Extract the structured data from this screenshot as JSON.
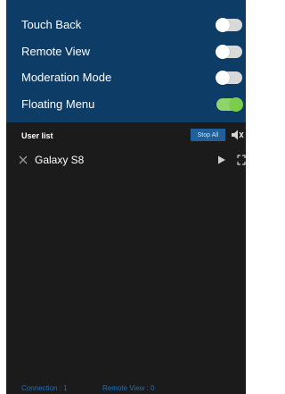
{
  "settings": [
    {
      "label": "Touch Back",
      "on": false
    },
    {
      "label": "Remote View",
      "on": false
    },
    {
      "label": "Moderation Mode",
      "on": false
    },
    {
      "label": "Floating Menu",
      "on": true
    }
  ],
  "user_list": {
    "title": "User list",
    "stop_all_label": "Stop All",
    "devices": [
      {
        "name": "Galaxy S8"
      }
    ]
  },
  "footer": {
    "connection": "Connection : 1",
    "remote_view": "Remote View : 0"
  },
  "colors": {
    "settings_bg": "#0d3c66",
    "list_bg": "#1b1b1b",
    "toggle_on": "#7ccc4d",
    "accent_blue": "#1f6fb8"
  }
}
